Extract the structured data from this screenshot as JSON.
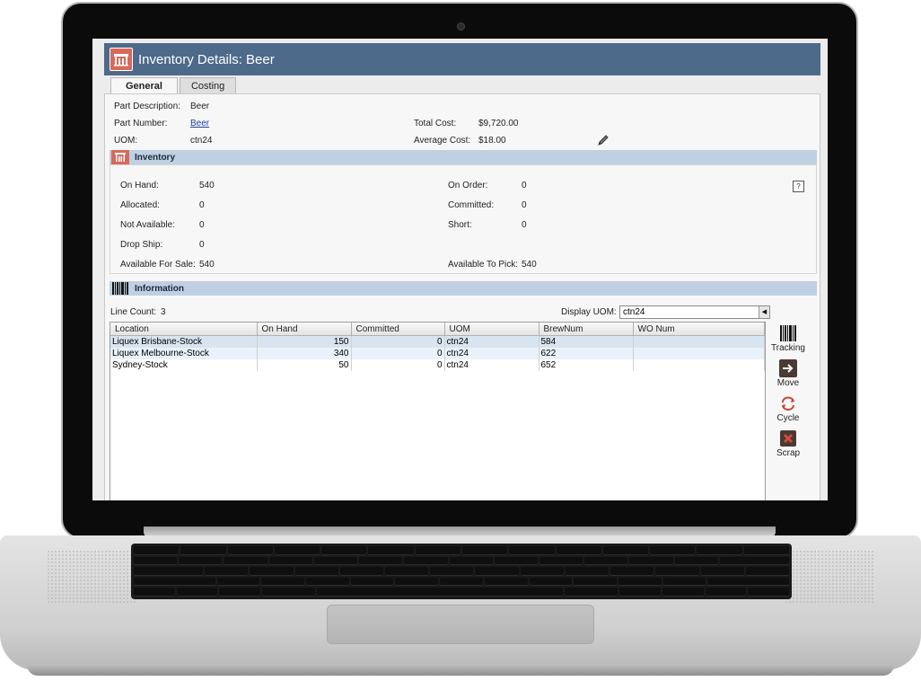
{
  "window": {
    "title": "Inventory Details: Beer"
  },
  "tabs": [
    {
      "label": "General"
    },
    {
      "label": "Costing"
    }
  ],
  "part": {
    "description_label": "Part Description:",
    "description_value": "Beer",
    "number_label": "Part Number:",
    "number_value": "Beer",
    "uom_label": "UOM:",
    "uom_value": "ctn24",
    "total_cost_label": "Total Cost:",
    "total_cost_value": "$9,720.00",
    "average_cost_label": "Average Cost:",
    "average_cost_value": "$18.00"
  },
  "inventory": {
    "title": "Inventory",
    "on_hand_label": "On Hand:",
    "on_hand_value": "540",
    "allocated_label": "Allocated:",
    "allocated_value": "0",
    "not_available_label": "Not Available:",
    "not_available_value": "0",
    "drop_ship_label": "Drop Ship:",
    "drop_ship_value": "0",
    "available_for_sale_label": "Available For Sale:",
    "available_for_sale_value": "540",
    "on_order_label": "On Order:",
    "on_order_value": "0",
    "committed_label": "Committed:",
    "committed_value": "0",
    "short_label": "Short:",
    "short_value": "0",
    "available_to_pick_label": "Available To Pick:",
    "available_to_pick_value": "540",
    "help_glyph": "?"
  },
  "information": {
    "title": "Information",
    "line_count_label": "Line Count:",
    "line_count_value": "3",
    "display_uom_label": "Display UOM:",
    "display_uom_value": "ctn24",
    "columns": [
      "Location",
      "On Hand",
      "Committed",
      "UOM",
      "BrewNum",
      "WO Num"
    ],
    "rows": [
      {
        "location": "Liquex Brisbane-Stock",
        "on_hand": "150",
        "committed": "0",
        "uom": "ctn24",
        "brewnum": "584",
        "wo_num": ""
      },
      {
        "location": "Liquex Melbourne-Stock",
        "on_hand": "340",
        "committed": "0",
        "uom": "ctn24",
        "brewnum": "622",
        "wo_num": ""
      },
      {
        "location": "Sydney-Stock",
        "on_hand": "50",
        "committed": "0",
        "uom": "ctn24",
        "brewnum": "652",
        "wo_num": ""
      }
    ]
  },
  "actions": [
    {
      "label": "Tracking",
      "icon": "barcode-icon"
    },
    {
      "label": "Move",
      "icon": "move-arrow-icon"
    },
    {
      "label": "Cycle",
      "icon": "cycle-icon"
    },
    {
      "label": "Scrap",
      "icon": "scrap-icon"
    }
  ],
  "colors": {
    "title_bar": "#4d6a8a",
    "section_bar": "#bfd0e3",
    "app_icon": "#d9695a",
    "link": "#1f3f9f"
  }
}
